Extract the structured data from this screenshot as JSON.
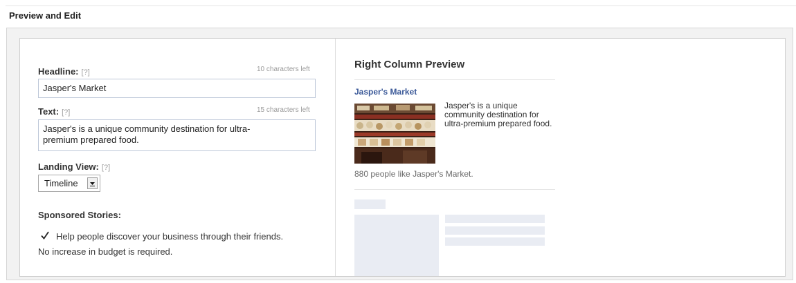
{
  "section": {
    "title": "Preview and Edit"
  },
  "form": {
    "headline": {
      "label": "Headline:",
      "help": "[?]",
      "counter": "10 characters left",
      "value": "Jasper's Market"
    },
    "text": {
      "label": "Text:",
      "help": "[?]",
      "counter": "15 characters left",
      "line1": "Jasper's is a unique community destination for ultra-",
      "line2": "premium prepared food."
    },
    "landing_view": {
      "label": "Landing View:",
      "help": "[?]",
      "selected": "Timeline",
      "arrow_icon": "dropdown-arrow-icon"
    },
    "sponsored": {
      "heading": "Sponsored Stories:",
      "checked": true,
      "line1": "Help people discover your business through their friends.",
      "line2": "No increase in budget is required."
    }
  },
  "preview": {
    "title": "Right Column Preview",
    "ad_title": "Jasper's Market",
    "ad_text": "Jasper's is a unique community destination for ultra-premium prepared food.",
    "likes": "880 people like Jasper's Market.",
    "image_icon": "market-photo"
  },
  "colors": {
    "link": "#3b5998",
    "input_border": "#bdc7d8",
    "placeholder": "#e9ecf3"
  }
}
